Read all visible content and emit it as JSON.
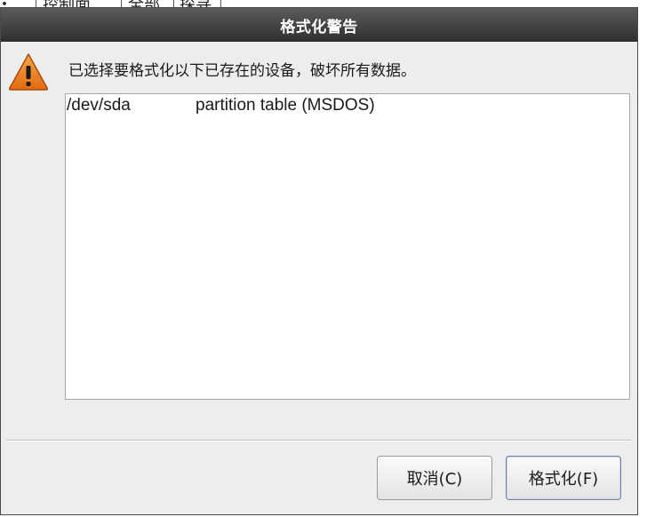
{
  "background": {
    "fragments": [
      "・",
      "控制面",
      "全部",
      "探寻"
    ]
  },
  "dialog": {
    "title": "格式化警告",
    "icon": "warning-triangle-icon",
    "message": "已选择要格式化以下已存在的设备，破坏所有数据。",
    "devices": [
      {
        "device": "/dev/sda",
        "description": "partition table (MSDOS)"
      }
    ],
    "buttons": {
      "cancel": "取消(C)",
      "format": "格式化(F)"
    }
  },
  "colors": {
    "titlebar": "#3a3a3a",
    "dialog_bg": "#ededed",
    "warning_orange": "#f08a24"
  }
}
